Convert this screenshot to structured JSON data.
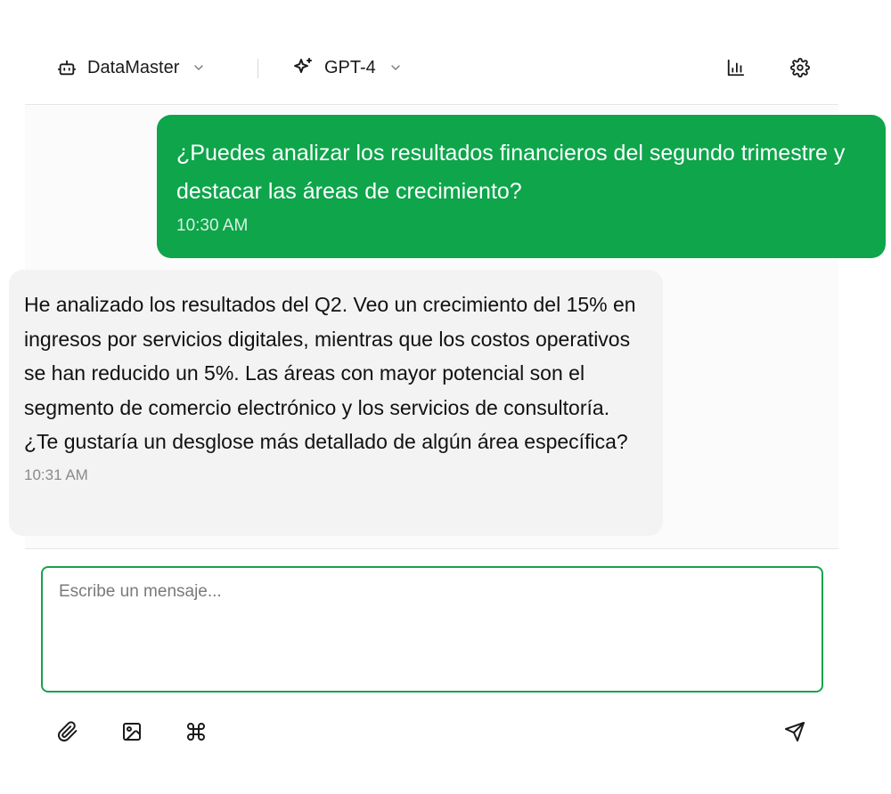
{
  "header": {
    "agent": {
      "label": "DataMaster",
      "icon": "bot-icon"
    },
    "model": {
      "label": "GPT-4",
      "icon": "sparkles-icon"
    },
    "actions": [
      {
        "icon": "bar-chart-icon"
      },
      {
        "icon": "gear-icon"
      }
    ]
  },
  "messages": [
    {
      "role": "user",
      "text": "¿Puedes analizar los resultados financieros del segundo trimestre y destacar las áreas de crecimiento?",
      "time": "10:30 AM"
    },
    {
      "role": "assistant",
      "text": "He analizado los resultados del Q2. Veo un crecimiento del 15% en ingresos por servicios digitales, mientras que los costos operativos se han reducido un 5%. Las áreas con mayor potencial son el segmento de comercio electrónico y los servicios de consultoría. ¿Te gustaría un desglose más detallado de algún área específica?",
      "time": "10:31 AM"
    }
  ],
  "composer": {
    "placeholder": "Escribe un mensaje...",
    "value": "",
    "tools": [
      "paperclip-icon",
      "image-icon",
      "command-icon"
    ],
    "send_icon": "send-icon"
  },
  "colors": {
    "accent": "#0ea54b",
    "input_border": "#17a34a",
    "assistant_bubble": "#f3f3f3"
  }
}
